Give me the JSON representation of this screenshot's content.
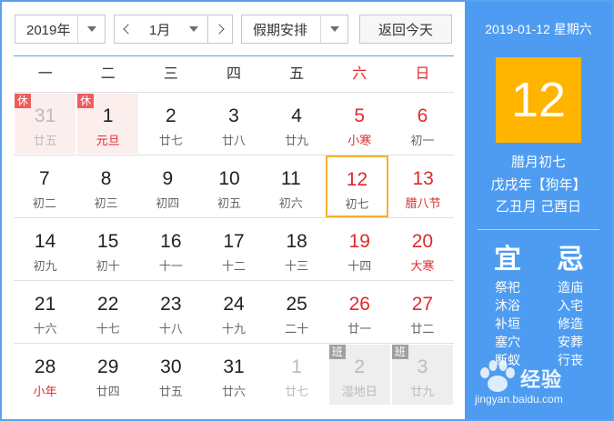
{
  "toolbar": {
    "year_value": "2019年",
    "month_value": "1月",
    "holiday_value": "假期安排",
    "today_label": "返回今天"
  },
  "weekdays": [
    "一",
    "二",
    "三",
    "四",
    "五",
    "六",
    "日"
  ],
  "weeks": [
    [
      {
        "day": "31",
        "lunar": "廿五",
        "other_month": true,
        "badge": "休",
        "badge_type": "rest"
      },
      {
        "day": "1",
        "lunar": "元旦",
        "festival": true,
        "badge": "休",
        "badge_type": "rest"
      },
      {
        "day": "2",
        "lunar": "廿七"
      },
      {
        "day": "3",
        "lunar": "廿八"
      },
      {
        "day": "4",
        "lunar": "廿九"
      },
      {
        "day": "5",
        "lunar": "小寒",
        "weekend": true,
        "festival": true
      },
      {
        "day": "6",
        "lunar": "初一",
        "weekend": true
      }
    ],
    [
      {
        "day": "7",
        "lunar": "初二"
      },
      {
        "day": "8",
        "lunar": "初三"
      },
      {
        "day": "9",
        "lunar": "初四"
      },
      {
        "day": "10",
        "lunar": "初五"
      },
      {
        "day": "11",
        "lunar": "初六"
      },
      {
        "day": "12",
        "lunar": "初七",
        "weekend": true,
        "today": true
      },
      {
        "day": "13",
        "lunar": "腊八节",
        "weekend": true,
        "festival": true
      }
    ],
    [
      {
        "day": "14",
        "lunar": "初九"
      },
      {
        "day": "15",
        "lunar": "初十"
      },
      {
        "day": "16",
        "lunar": "十一"
      },
      {
        "day": "17",
        "lunar": "十二"
      },
      {
        "day": "18",
        "lunar": "十三"
      },
      {
        "day": "19",
        "lunar": "十四",
        "weekend": true
      },
      {
        "day": "20",
        "lunar": "大寒",
        "weekend": true,
        "festival": true
      }
    ],
    [
      {
        "day": "21",
        "lunar": "十六"
      },
      {
        "day": "22",
        "lunar": "十七"
      },
      {
        "day": "23",
        "lunar": "十八"
      },
      {
        "day": "24",
        "lunar": "十九"
      },
      {
        "day": "25",
        "lunar": "二十"
      },
      {
        "day": "26",
        "lunar": "廿一",
        "weekend": true
      },
      {
        "day": "27",
        "lunar": "廿二",
        "weekend": true
      }
    ],
    [
      {
        "day": "28",
        "lunar": "小年",
        "festival": true
      },
      {
        "day": "29",
        "lunar": "廿四"
      },
      {
        "day": "30",
        "lunar": "廿五"
      },
      {
        "day": "31",
        "lunar": "廿六"
      },
      {
        "day": "1",
        "lunar": "廿七",
        "other_month": true
      },
      {
        "day": "2",
        "lunar": "湿地日",
        "other_month": true,
        "badge": "班",
        "badge_type": "work"
      },
      {
        "day": "3",
        "lunar": "廿九",
        "other_month": true,
        "badge": "班",
        "badge_type": "work"
      }
    ]
  ],
  "side_panel": {
    "date_line": "2019-01-12 星期六",
    "big_day": "12",
    "lunar_date": "腊月初七",
    "ganzhi_year": "戊戌年【狗年】",
    "ganzhi_month_day": "乙丑月 己酉日",
    "yi_label": "宜",
    "ji_label": "忌",
    "yi_items": [
      "祭祀",
      "沐浴",
      "补垣",
      "塞穴",
      "断蚁"
    ],
    "ji_items": [
      "造庙",
      "入宅",
      "修造",
      "安葬",
      "行丧"
    ]
  },
  "watermark": {
    "brand": "经验",
    "url": "jingyan.baidu.com"
  },
  "colors": {
    "accent_blue": "#4e9cf1",
    "today_highlight": "#ffb400",
    "weekend_red": "#e02a2a",
    "rest_badge": "#ee5d5d",
    "work_badge": "#a0a0a0"
  }
}
